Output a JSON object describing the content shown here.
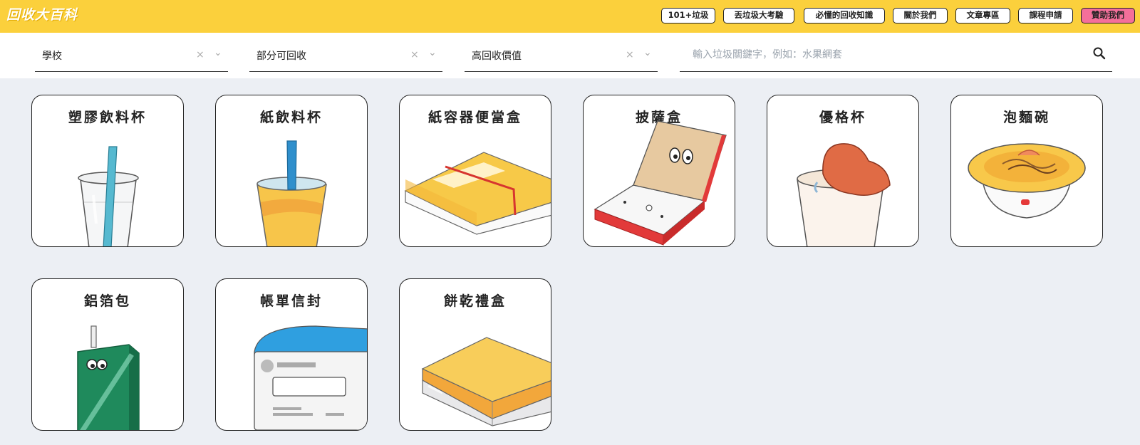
{
  "header": {
    "logo": "回收大百科",
    "nav": [
      "101+垃圾",
      "丟垃圾大考驗",
      "必懂的回收知識",
      "關於我們",
      "文章專區",
      "課程申請",
      "贊助我們"
    ]
  },
  "filters": {
    "location": "學校",
    "recyclability": "部分可回收",
    "value": "高回收價值",
    "clear_icon": "×",
    "chevron_icon": "⌄"
  },
  "search": {
    "placeholder": "輸入垃圾關鍵字，例如：水果網套"
  },
  "items": [
    "塑膠飲料杯",
    "紙飲料杯",
    "紙容器便當盒",
    "披薩盒",
    "優格杯",
    "泡麵碗",
    "鋁箔包",
    "帳單信封",
    "餅乾禮盒"
  ],
  "colors": {
    "header": "#fbd03c",
    "sponsor": "#f46f9a",
    "background": "#eceff4"
  }
}
